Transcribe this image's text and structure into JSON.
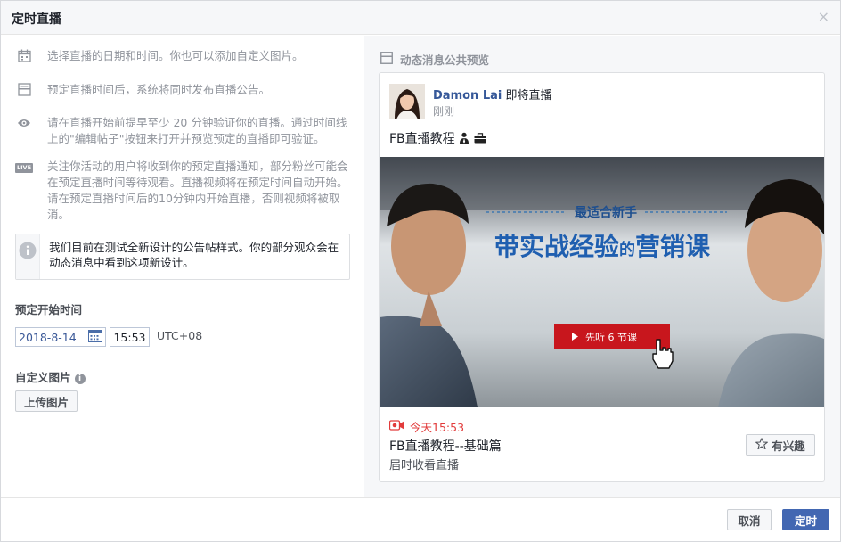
{
  "dialog": {
    "title": "定时直播",
    "close_glyph": "×"
  },
  "info_rows": [
    {
      "icon": "calendar-icon",
      "text": "选择直播的日期和时间。你也可以添加自定义图片。"
    },
    {
      "icon": "post-icon",
      "text": "预定直播时间后，系统将同时发布直播公告。"
    },
    {
      "icon": "eye-icon",
      "text": "请在直播开始前提早至少 20 分钟验证你的直播。通过时间线上的\"编辑帖子\"按钮来打开并预览预定的直播即可验证。"
    },
    {
      "icon": "live-icon",
      "live_badge": "LIVE",
      "text": "关注你活动的用户将收到你的预定直播通知，部分粉丝可能会在预定直播时间等待观看。直播视频将在预定时间自动开始。请在预定直播时间后的10分钟内开始直播，否则视频将被取消。"
    }
  ],
  "notice": {
    "icon": "info-icon",
    "text": "我们目前在测试全新设计的公告帖样式。你的部分观众会在动态消息中看到这项新设计。"
  },
  "schedule": {
    "label": "预定开始时间",
    "date": "2018-8-14",
    "time": "15:53",
    "timezone": "UTC+08"
  },
  "custom_image": {
    "label": "自定义图片",
    "help": "i",
    "upload_label": "上传图片"
  },
  "preview": {
    "label": "动态消息公共预览",
    "author": "Damon Lai",
    "verb": " 即将直播",
    "ago": "刚刚",
    "post_text": "FB直播教程",
    "media": {
      "subtitle": "最适合新手",
      "headline_a": "带实战经验",
      "headline_b": "的",
      "headline_c": "营销课",
      "cta": "先听 6 节课"
    },
    "live_time": "今天15:53",
    "event_title": "FB直播教程--基础篇",
    "watch_text": "届时收看直播",
    "interest_label": "有兴趣"
  },
  "footer": {
    "cancel_label": "取消",
    "submit_label": "定时"
  },
  "colors": {
    "accent": "#4267b2",
    "link": "#365899",
    "live_red": "#e23b3b",
    "muted": "#90949c"
  }
}
